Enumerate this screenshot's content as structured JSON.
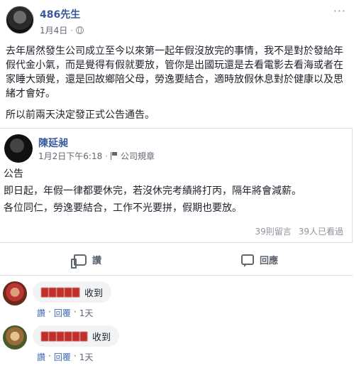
{
  "post": {
    "author": "486先生",
    "date": "1月4日",
    "separator": "·",
    "menu": "···",
    "paragraphs": [
      "去年居然發生公司成立至今以來第一起年假沒放完的事情，我不是對於發給年假代金小氣，而是覺得有假就要放，管你是出國玩還是去看電影去看海或者在家睡大頭覺，還是回故鄉陪父母，勞逸要結合，適時放假休息對於健康以及思緒才會好。",
      "所以前兩天決定發正式公告通告。"
    ]
  },
  "shared": {
    "author": "陳延昶",
    "date": "1月2日下午6:18",
    "separator": "·",
    "group": "公司規章",
    "lines": [
      "公告",
      "即日起，年假一律都要休完，若沒休完考績將打丙，隔年將會減薪。",
      "各位同仁，勞逸要結合，工作不光要拼，假期也要放。"
    ],
    "comments_count": "39則留言",
    "shares_count": "39人已看過"
  },
  "actions": {
    "like": "讚",
    "comment": "回應"
  },
  "comments": [
    {
      "name": "▇▇▇▇▇",
      "text": "收到",
      "like": "讚",
      "reply": "回覆",
      "sep": "·",
      "time": "1天"
    },
    {
      "name": "▇▇▇▇▇▇",
      "text": "收到",
      "like": "讚",
      "reply": "回覆",
      "sep": "·",
      "time": "1天"
    }
  ]
}
